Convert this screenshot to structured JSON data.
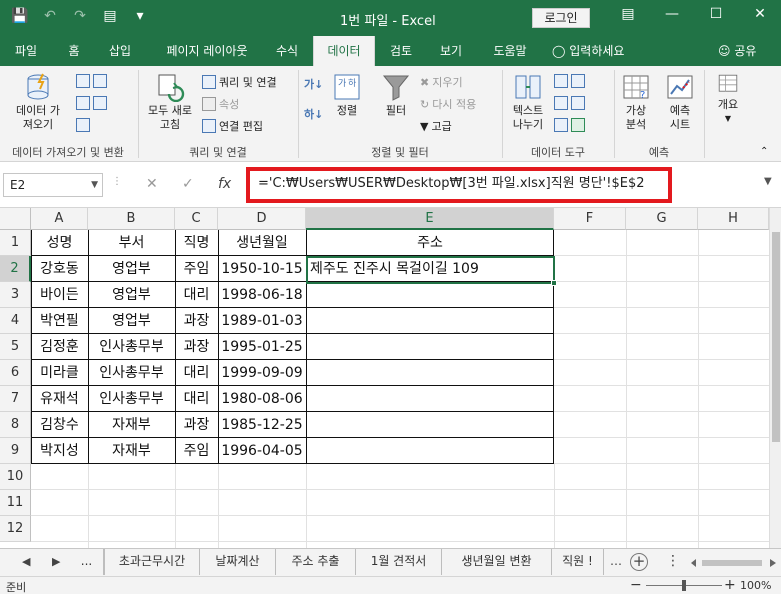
{
  "window": {
    "title": "1번 파일  -  Excel",
    "login_label": "로그인",
    "controls": [
      "minimize-icon",
      "maximize-icon",
      "close-icon"
    ]
  },
  "ribbon_tabs": [
    "파일",
    "홈",
    "삽입",
    "페이지 레이아웃",
    "수식",
    "데이터",
    "검토",
    "보기",
    "도움말"
  ],
  "active_tab": "데이터",
  "tell_me": "입력하세요",
  "share": "공유",
  "ribbon": {
    "get_data": "데이터 가져오기",
    "get_data_l1": "데이터 가",
    "get_data_l2": "져오기",
    "group_get_transform": "데이터 가져오기 및 변환",
    "refresh_l1": "모두 새로",
    "refresh_l2": "고침",
    "queries_connections": "쿼리 및 연결",
    "properties": "속성",
    "edit_links": "연결 편집",
    "group_queries": "쿼리 및 연결",
    "sort": "정렬",
    "filter": "필터",
    "clear": "지우기",
    "reapply": "다시 적용",
    "advanced": "고급",
    "group_sort_filter": "정렬 및 필터",
    "text_to_columns_l1": "텍스트",
    "text_to_columns_l2": "나누기",
    "group_data_tools": "데이터 도구",
    "whatif_l1": "가상",
    "whatif_l2": "분석",
    "forecast_l1": "예측",
    "forecast_l2": "시트",
    "group_forecast": "예측",
    "outline": "개요"
  },
  "formula_bar": {
    "name_box": "E2",
    "formula": "='C:₩Users₩USER₩Desktop₩[3번 파일.xlsx]직원 명단'!$E$2"
  },
  "columns": [
    "A",
    "B",
    "C",
    "D",
    "E",
    "F",
    "G",
    "H"
  ],
  "rows": [
    "1",
    "2",
    "3",
    "4",
    "5",
    "6",
    "7",
    "8",
    "9",
    "10",
    "11",
    "12"
  ],
  "selected": {
    "column": "E",
    "row": "2"
  },
  "table": {
    "headers": [
      "성명",
      "부서",
      "직명",
      "생년월일",
      "주소"
    ],
    "rows": [
      [
        "강호동",
        "영업부",
        "주임",
        "1950-10-15",
        "제주도 진주시 목걸이길 109"
      ],
      [
        "바이든",
        "영업부",
        "대리",
        "1998-06-18",
        ""
      ],
      [
        "박연필",
        "영업부",
        "과장",
        "1989-01-03",
        ""
      ],
      [
        "김정훈",
        "인사총무부",
        "과장",
        "1995-01-25",
        ""
      ],
      [
        "미라클",
        "인사총무부",
        "대리",
        "1999-09-09",
        ""
      ],
      [
        "유재석",
        "인사총무부",
        "대리",
        "1980-08-06",
        ""
      ],
      [
        "김창수",
        "자재부",
        "과장",
        "1985-12-25",
        ""
      ],
      [
        "박지성",
        "자재부",
        "주임",
        "1996-04-05",
        ""
      ]
    ]
  },
  "sheet_tabs": [
    "...",
    "초과근무시간",
    "날짜계산",
    "주소 추출",
    "1월 견적서",
    "생년월일 변환",
    "직원 !"
  ],
  "status": {
    "ready": "준비",
    "zoom": "100%"
  }
}
